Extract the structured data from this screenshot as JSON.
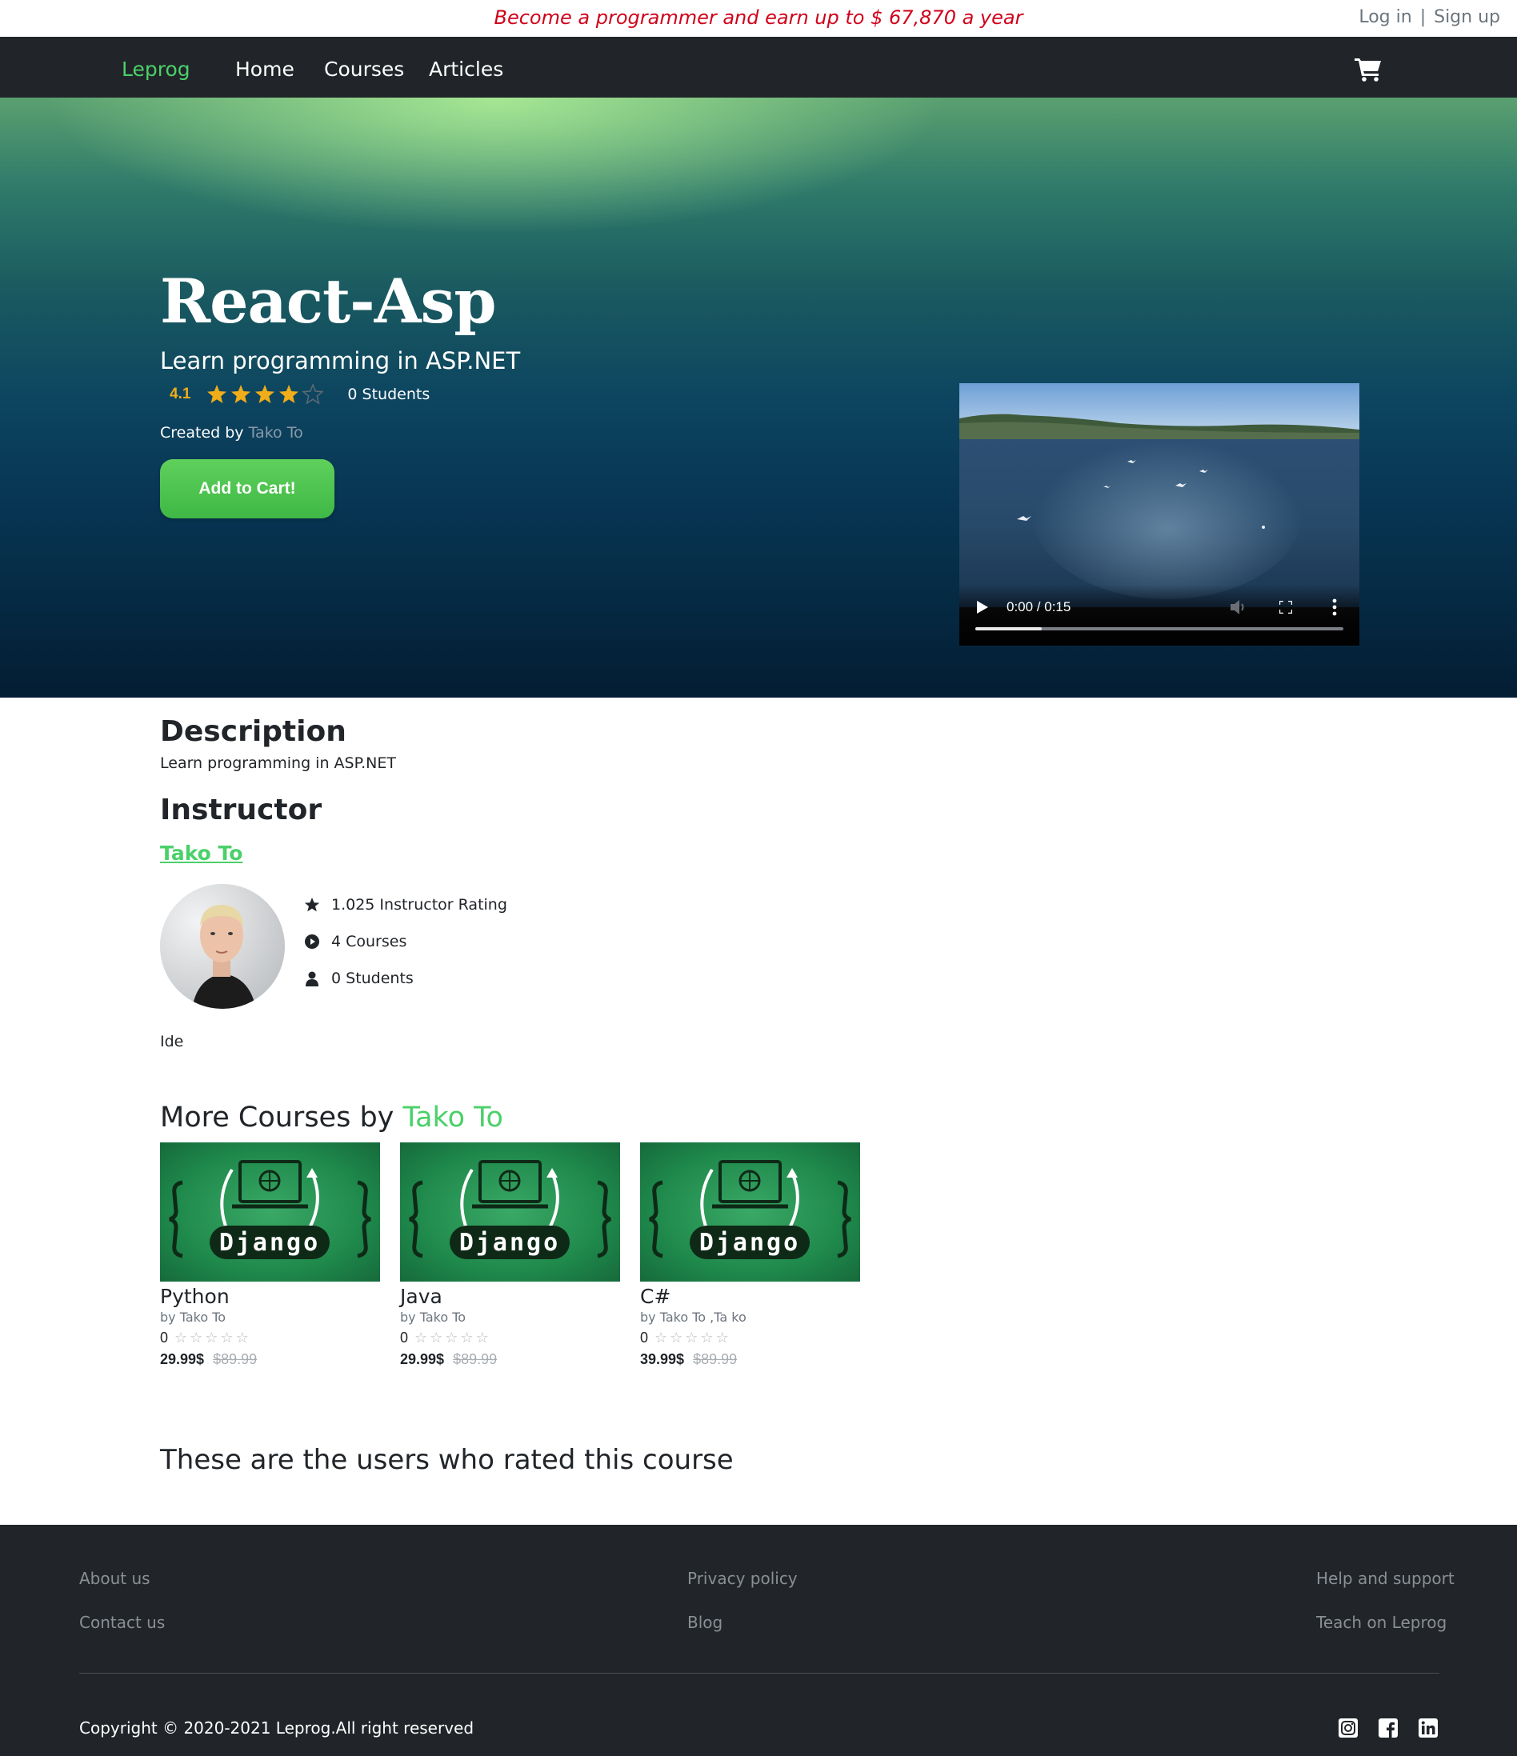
{
  "promo": {
    "text": "Become a programmer and earn up to $ 67,870 a year"
  },
  "auth": {
    "login": "Log in",
    "separator": "|",
    "signup": "Sign up"
  },
  "nav": {
    "brand": "Leprog",
    "links": [
      "Home",
      "Courses",
      "Articles"
    ],
    "cart_icon": "cart-icon"
  },
  "hero": {
    "title": "React-Asp",
    "subtitle": "Learn programming in ASP.NET",
    "rating": "4.1",
    "rating_value": 4.1,
    "rating_max": 5,
    "students": "0 Students",
    "created_by_label": "Created by",
    "creator": "Tako To",
    "cart_button": "Add to Cart!"
  },
  "video": {
    "time": "0:00 / 0:15",
    "progress": 0.18
  },
  "description": {
    "heading": "Description",
    "text": "Learn programming in ASP.NET"
  },
  "instructor": {
    "heading": "Instructor",
    "name": "Tako To",
    "stats": [
      {
        "icon": "star-icon",
        "text": "1.025 Instructor Rating"
      },
      {
        "icon": "play-circle-icon",
        "text": "4 Courses"
      },
      {
        "icon": "user-icon",
        "text": "0 Students"
      }
    ],
    "bio": "Ide"
  },
  "more_courses": {
    "heading_prefix": "More Courses by",
    "heading_name": "Tako To",
    "thumbnail_label": "Django",
    "cards": [
      {
        "title": "Python",
        "author": "by Tako To",
        "rating": "0",
        "stars": "☆☆☆☆☆",
        "price": "29.99$",
        "old_price": "$89.99"
      },
      {
        "title": "Java",
        "author": "by Tako To",
        "rating": "0",
        "stars": "☆☆☆☆☆",
        "price": "29.99$",
        "old_price": "$89.99"
      },
      {
        "title": "C#",
        "author": "by Tako To ,Ta ko",
        "rating": "0",
        "stars": "☆☆☆☆☆",
        "price": "39.99$",
        "old_price": "$89.99"
      }
    ]
  },
  "rated_heading": "These are the users who rated this course",
  "footer": {
    "links": [
      "About us",
      "Contact us",
      "Privacy policy",
      "Blog",
      "Help and support",
      "Teach on Leprog"
    ],
    "copyright": "Copyright © 2020-2021 Leprog.All right reserved",
    "social_icons": [
      "instagram-icon",
      "facebook-icon",
      "linkedin-icon"
    ]
  },
  "colors": {
    "accent": "#4bd06a",
    "promo": "#d0021b",
    "star": "#f0ad1a",
    "navbar": "#212529"
  }
}
